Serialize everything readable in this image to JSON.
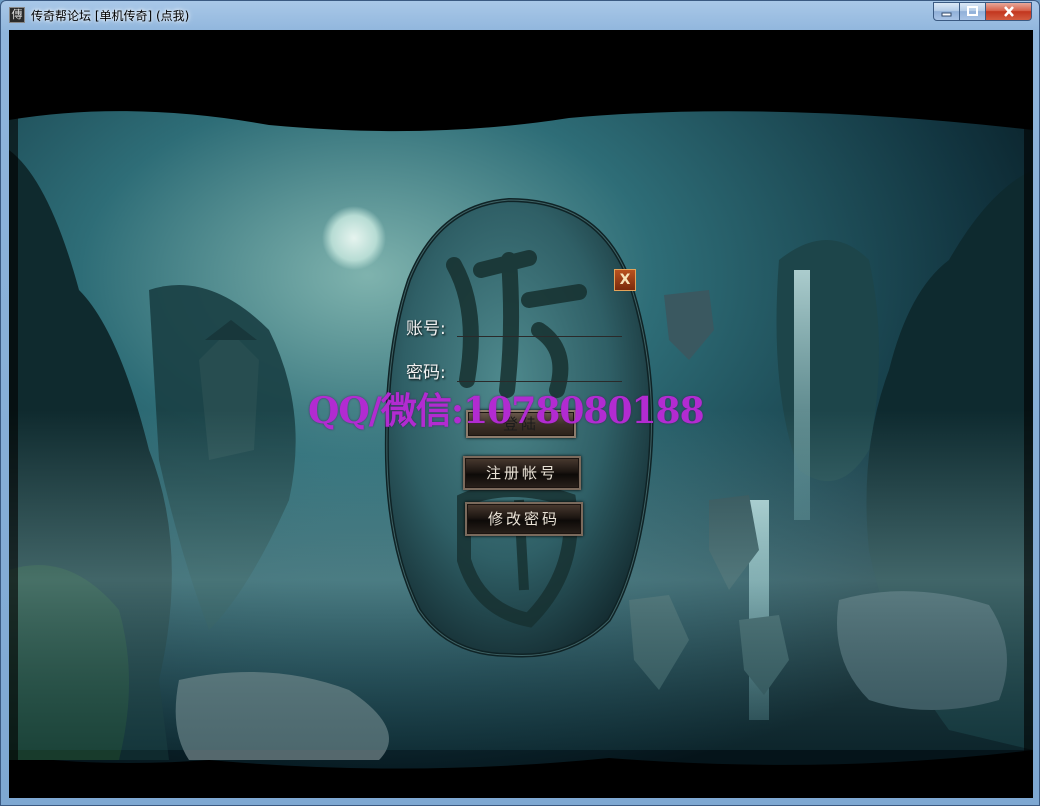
{
  "window": {
    "title": "传奇帮论坛 [单机传奇] (点我)",
    "icon": "legend-app-icon",
    "controls": {
      "minimize": "–",
      "maximize": "□",
      "close": "X"
    }
  },
  "login": {
    "close_label": "X",
    "account_label": "账号:",
    "account_value": "",
    "password_label": "密码:",
    "password_value": "",
    "login_button": "登陆",
    "register_button": "注册帐号",
    "change_password_button": "修改密码"
  },
  "watermark": "QQ/微信:1078080188",
  "colors": {
    "watermark": "#b22bd1",
    "close_button": "#b9521f",
    "titlebar": "#a9c8e8"
  }
}
